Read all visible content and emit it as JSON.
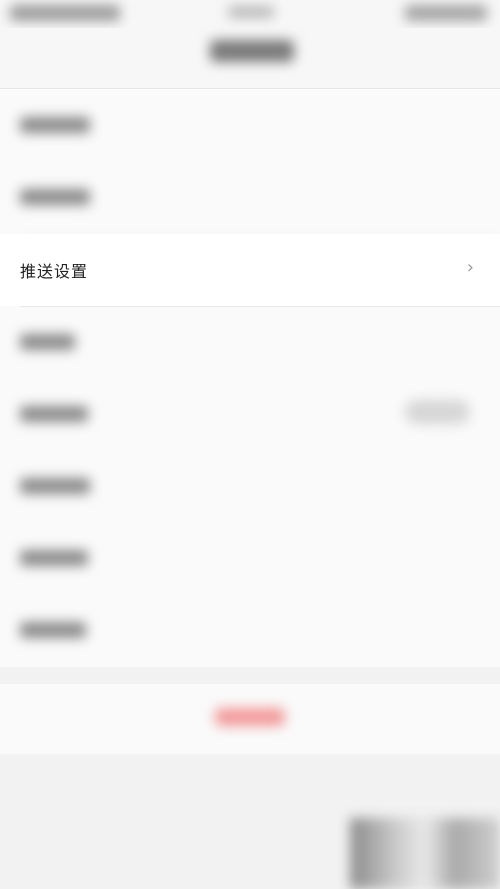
{
  "settings": {
    "push_settings_label": "推送设置",
    "chevron": "›"
  }
}
